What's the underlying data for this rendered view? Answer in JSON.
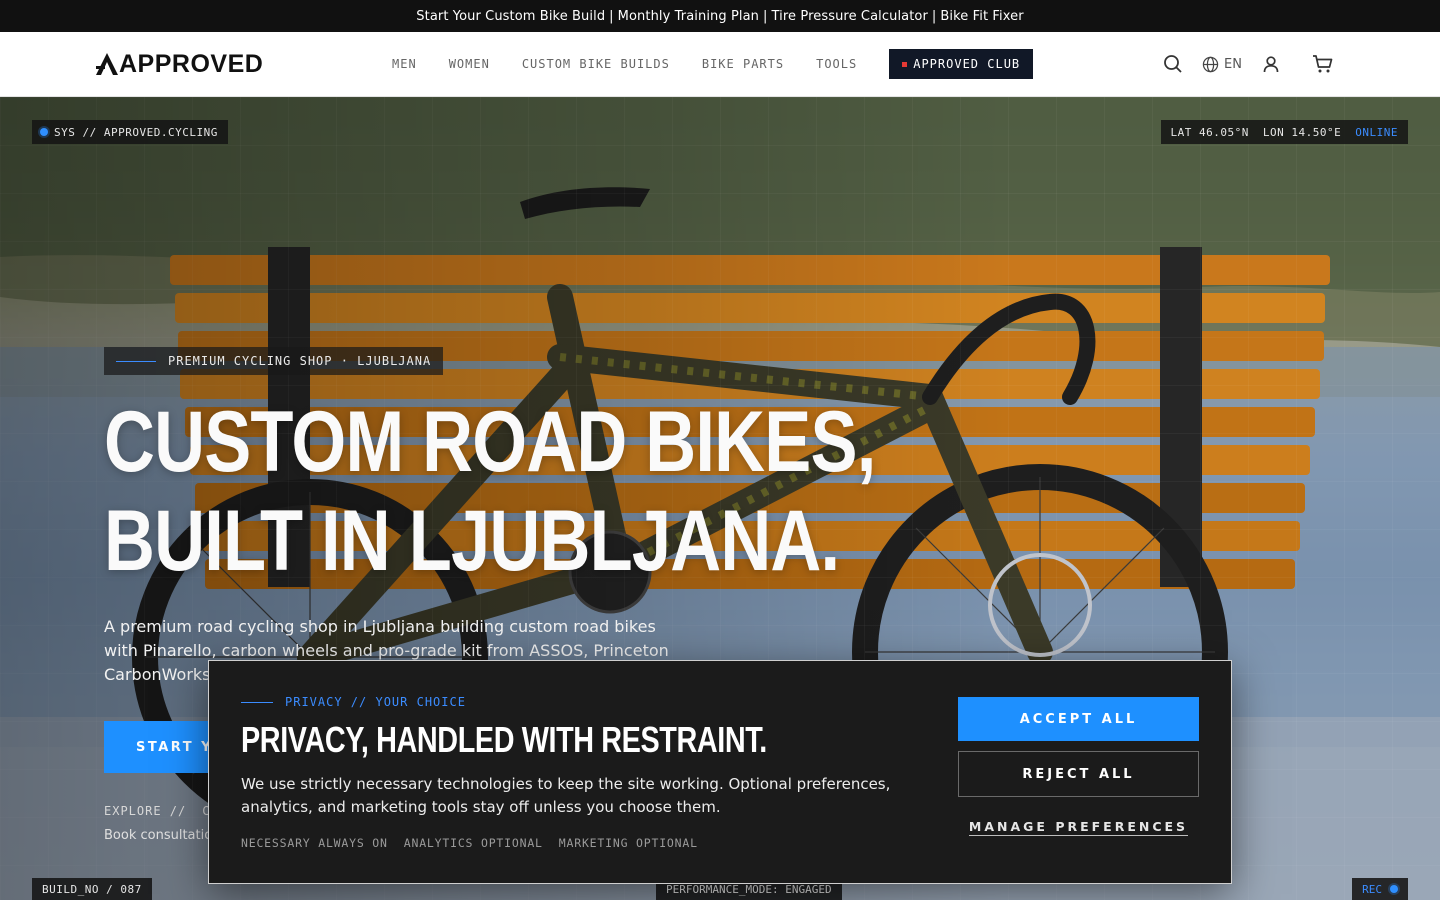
{
  "announcement": {
    "links": [
      "Start Your Custom Bike Build",
      "Monthly Training Plan",
      "Tire Pressure Calculator",
      "Bike Fit Fixer"
    ],
    "separator": "|"
  },
  "header": {
    "logo_text": "APPROVED",
    "nav": [
      "MEN",
      "WOMEN",
      "CUSTOM BIKE BUILDS",
      "BIKE PARTS",
      "TOOLS"
    ],
    "club_label": "APPROVED CLUB",
    "language": "EN",
    "icons": [
      "search-icon",
      "globe-icon",
      "user-icon",
      "cart-icon"
    ]
  },
  "hero": {
    "sys_label": "SYS // APPROVED.CYCLING",
    "lat": "LAT 46.05°N",
    "lon": "LON 14.50°E",
    "status": "ONLINE",
    "eyebrow": "PREMIUM CYCLING SHOP · LJUBLJANA",
    "title_line1": "CUSTOM ROAD BIKES,",
    "title_line2": "BUILT IN LJUBLJANA.",
    "subtitle": "A premium road cycling shop in Ljubljana building custom road bikes with Pinarello, carbon wheels and pro-grade kit from ASSOS, Princeton CarbonWorks",
    "cta_label": "START YO",
    "explore_label": "EXPLORE //",
    "explore_next": "C",
    "book_text": "Book consultatio",
    "build_no": "BUILD_NO / 087",
    "performance": "PERFORMANCE_MODE: ENGAGED",
    "rec": "REC"
  },
  "cookie": {
    "eyebrow": "PRIVACY // YOUR CHOICE",
    "title": "PRIVACY, HANDLED WITH RESTRAINT.",
    "body": "We use strictly necessary technologies to keep the site working. Optional preferences, analytics, and marketing tools stay off unless you choose them.",
    "tags": [
      "NECESSARY ALWAYS ON",
      "ANALYTICS OPTIONAL",
      "MARKETING OPTIONAL"
    ],
    "accept": "ACCEPT ALL",
    "reject": "REJECT ALL",
    "manage": "MANAGE PREFERENCES"
  },
  "colors": {
    "accent": "#1e90ff",
    "dark": "#111111",
    "club_bg": "#111827",
    "club_dot": "#e53935"
  }
}
